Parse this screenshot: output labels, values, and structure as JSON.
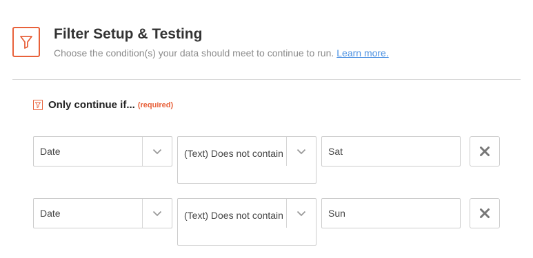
{
  "header": {
    "icon": "filter-icon",
    "title": "Filter Setup & Testing",
    "subtitle": "Choose the condition(s) your data should meet to continue to run.",
    "learn_more": "Learn more."
  },
  "section": {
    "icon": "filter-icon",
    "label": "Only continue if...",
    "required": "(required)"
  },
  "rows": [
    {
      "field": "Date",
      "condition": "(Text) Does not contain",
      "value": "Sat"
    },
    {
      "field": "Date",
      "condition": "(Text) Does not contain",
      "value": "Sun"
    }
  ],
  "colors": {
    "accent": "#e8613a",
    "link": "#4a90e2",
    "border": "#cccccc"
  }
}
